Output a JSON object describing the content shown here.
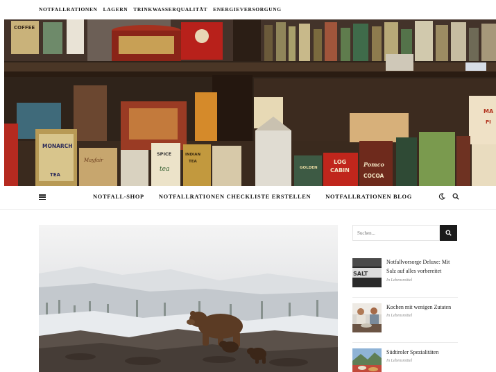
{
  "top_nav": [
    "NOTFALLRATIONEN",
    "LAGERN",
    "TRINKWASSERQUALITÄT",
    "ENERGIEVERSORGUNG"
  ],
  "main_nav": [
    "NOTFALL-SHOP",
    "NOTFALLRATIONEN CHECKLISTE ERSTELLEN",
    "NOTFALLRATIONEN BLOG"
  ],
  "icons": {
    "menu": "hamburger-menu-icon",
    "theme": "moon-icon",
    "search": "search-icon"
  },
  "search": {
    "placeholder": "Suchen..."
  },
  "hero": {
    "tin_labels": [
      "COFFEE",
      "MONARCH",
      "TEA",
      "Mayfair",
      "SPICE",
      "tea",
      "INDIAN",
      "TEA",
      "LOG",
      "CABIN",
      "Pomco",
      "COCOA",
      "GOLDEN",
      "MA",
      "PI"
    ]
  },
  "sidebar_posts": [
    {
      "title": "Notfallvorsorge Deluxe: Mit Salz auf alles vorbereitet",
      "category": "In Lebensmittel",
      "thumb_text": "SALT"
    },
    {
      "title": "Kochen mit wenigen Zutaten",
      "category": "In Lebensmittel"
    },
    {
      "title": "Südtiroler Spezialitäten",
      "category": "In Lebensmittel"
    }
  ],
  "colors": {
    "dark": "#1b1b1b",
    "shelf_wood": "#3a2a1e",
    "category_gray": "#8a8a8a"
  }
}
